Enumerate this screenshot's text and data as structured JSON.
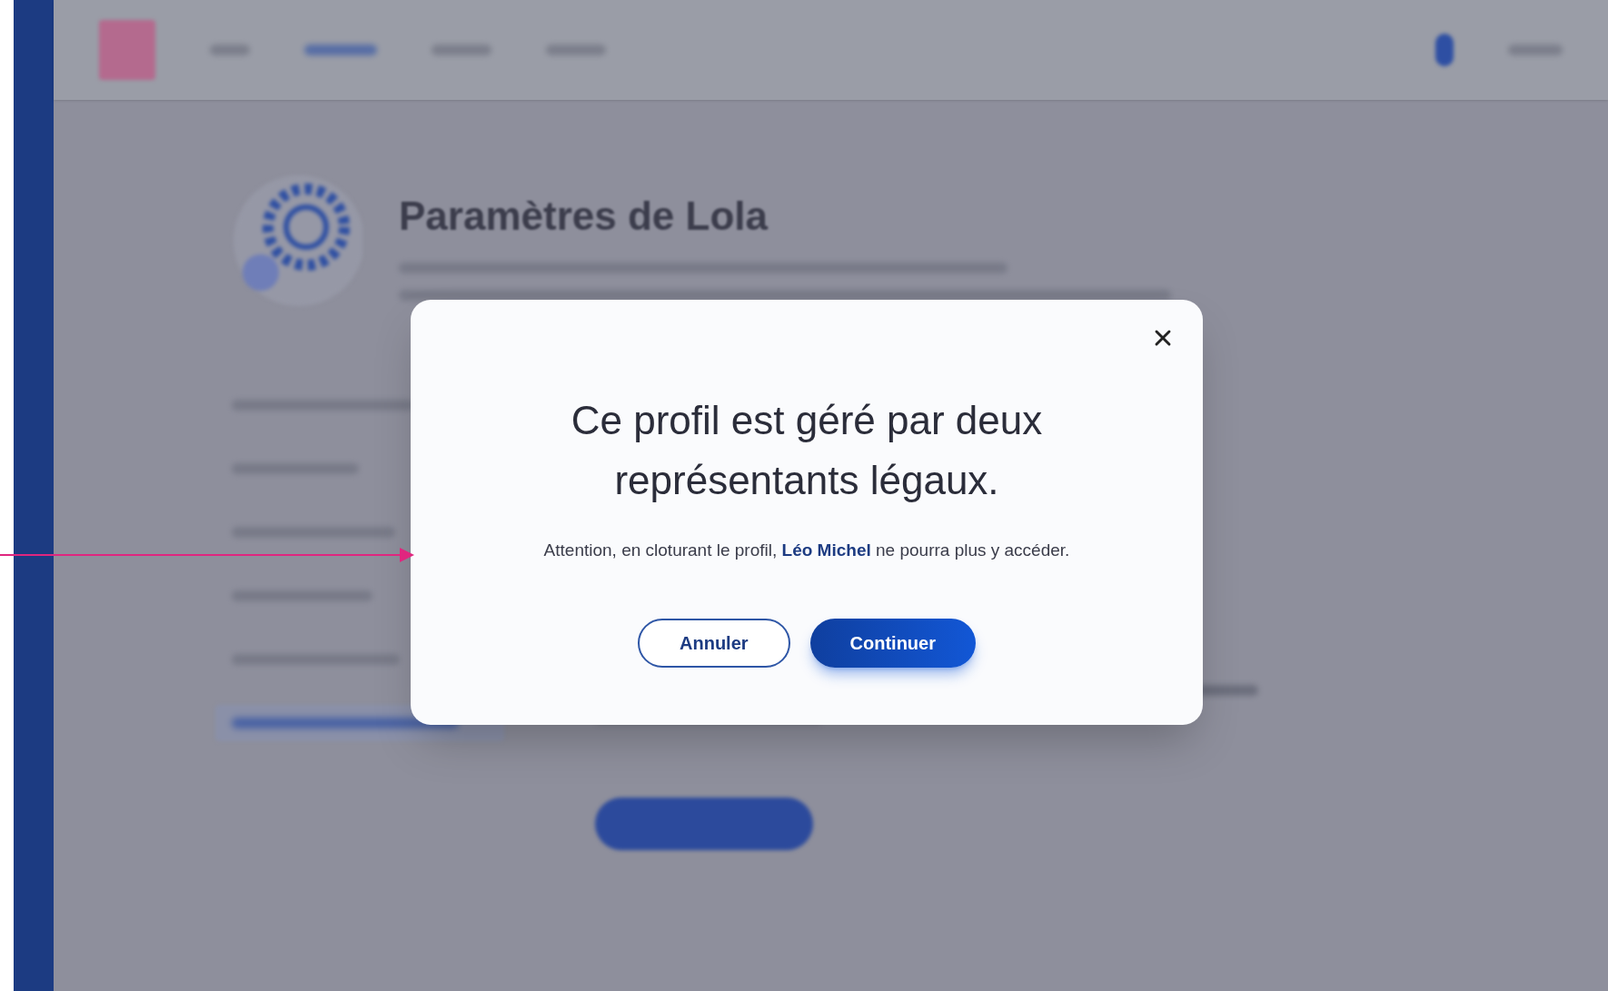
{
  "page": {
    "title": "Paramètres de Lola"
  },
  "modal": {
    "title": "Ce profil est géré par deux représentants légaux.",
    "body": "Attention, en cloturant le profil, **Léo Michel** ne pourra plus y accéder.",
    "buttons": [
      {
        "label": "Annuler",
        "kind": "secondary"
      },
      {
        "label": "Continuer",
        "kind": "primary"
      }
    ]
  }
}
